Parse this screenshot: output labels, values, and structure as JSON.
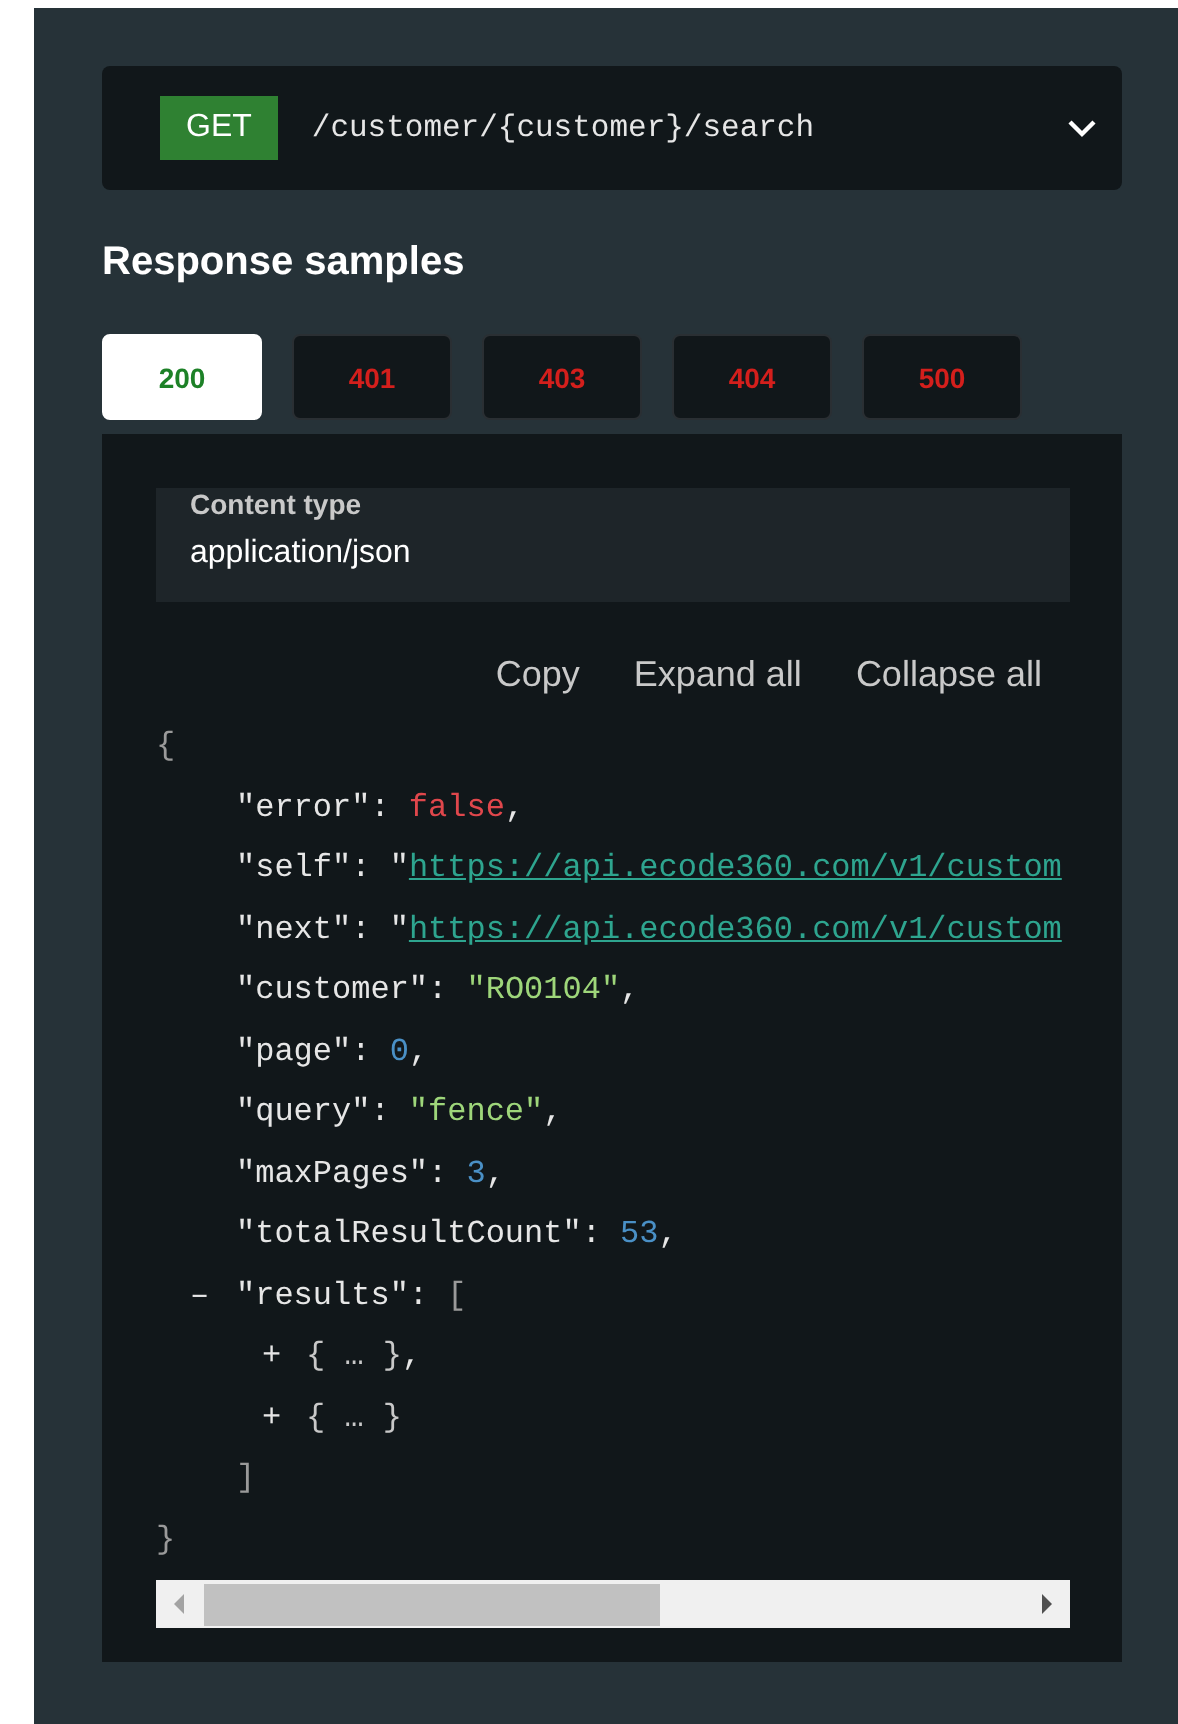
{
  "endpoint": {
    "method": "GET",
    "path": "/customer/{customer}/search",
    "expanded": false
  },
  "heading": "Response samples",
  "tabs": [
    {
      "label": "200",
      "selected": true,
      "kind": "success"
    },
    {
      "label": "401",
      "selected": false,
      "kind": "error"
    },
    {
      "label": "403",
      "selected": false,
      "kind": "error"
    },
    {
      "label": "404",
      "selected": false,
      "kind": "error"
    },
    {
      "label": "500",
      "selected": false,
      "kind": "error"
    }
  ],
  "content_type": {
    "label": "Content type",
    "value": "application/json"
  },
  "actions": [
    "Copy",
    "Expand all",
    "Collapse all"
  ],
  "code": {
    "open": "{",
    "close": "}",
    "members": [
      {
        "key": "\"error\":",
        "kind": "boolean",
        "value": "false",
        "suffix": ","
      },
      {
        "key": "\"self\":",
        "kind": "url",
        "quote": "\"",
        "value": "https://api.ecode360.com/v1/custom"
      },
      {
        "key": "\"next\":",
        "kind": "url",
        "quote": "\"",
        "value": "https://api.ecode360.com/v1/custom"
      },
      {
        "key": "\"customer\":",
        "kind": "string",
        "value": "\"RO0104\"",
        "suffix": ","
      },
      {
        "key": "\"page\":",
        "kind": "number",
        "value": "0",
        "suffix": ","
      },
      {
        "key": "\"query\":",
        "kind": "string",
        "value": "\"fence\"",
        "suffix": ","
      },
      {
        "key": "\"maxPages\":",
        "kind": "number",
        "value": "3",
        "suffix": ","
      },
      {
        "key": "\"totalResultCount\":",
        "kind": "number",
        "value": "53",
        "suffix": ","
      },
      {
        "key": "\"results\":",
        "kind": "array",
        "toggle": "–",
        "open": "[",
        "close": "]",
        "children": [
          {
            "kind": "collapsed",
            "toggle": "+",
            "value": "{ … }",
            "suffix": ","
          },
          {
            "kind": "collapsed",
            "toggle": "+",
            "value": "{ … }"
          }
        ]
      }
    ]
  }
}
